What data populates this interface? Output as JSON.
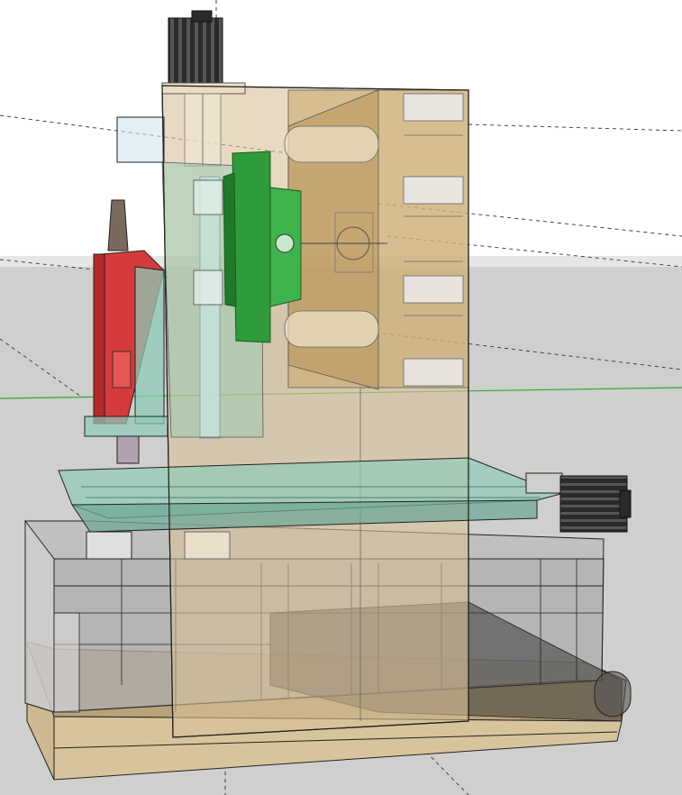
{
  "app": {
    "description_hidden": false
  },
  "viewport": {
    "sky_color": "#ffffff",
    "ground_color": "#cfcfcd",
    "axis_green": "#3aa33a",
    "guide_line_color": "#333333"
  },
  "model": {
    "parts": [
      {
        "name": "spindle-motor",
        "color": "#2b2b2b"
      },
      {
        "name": "column-body",
        "color": "#d9c29a"
      },
      {
        "name": "z-axis-carriage",
        "color": "#3fa33f"
      },
      {
        "name": "spindle-head",
        "color": "#d63b3b"
      },
      {
        "name": "xy-table",
        "color": "#8ecbb6"
      },
      {
        "name": "base-frame",
        "color": "#b9b9b9"
      },
      {
        "name": "base-plate",
        "color": "#cbb48a"
      },
      {
        "name": "x-axis-motor",
        "color": "#2b2b2b"
      }
    ]
  }
}
